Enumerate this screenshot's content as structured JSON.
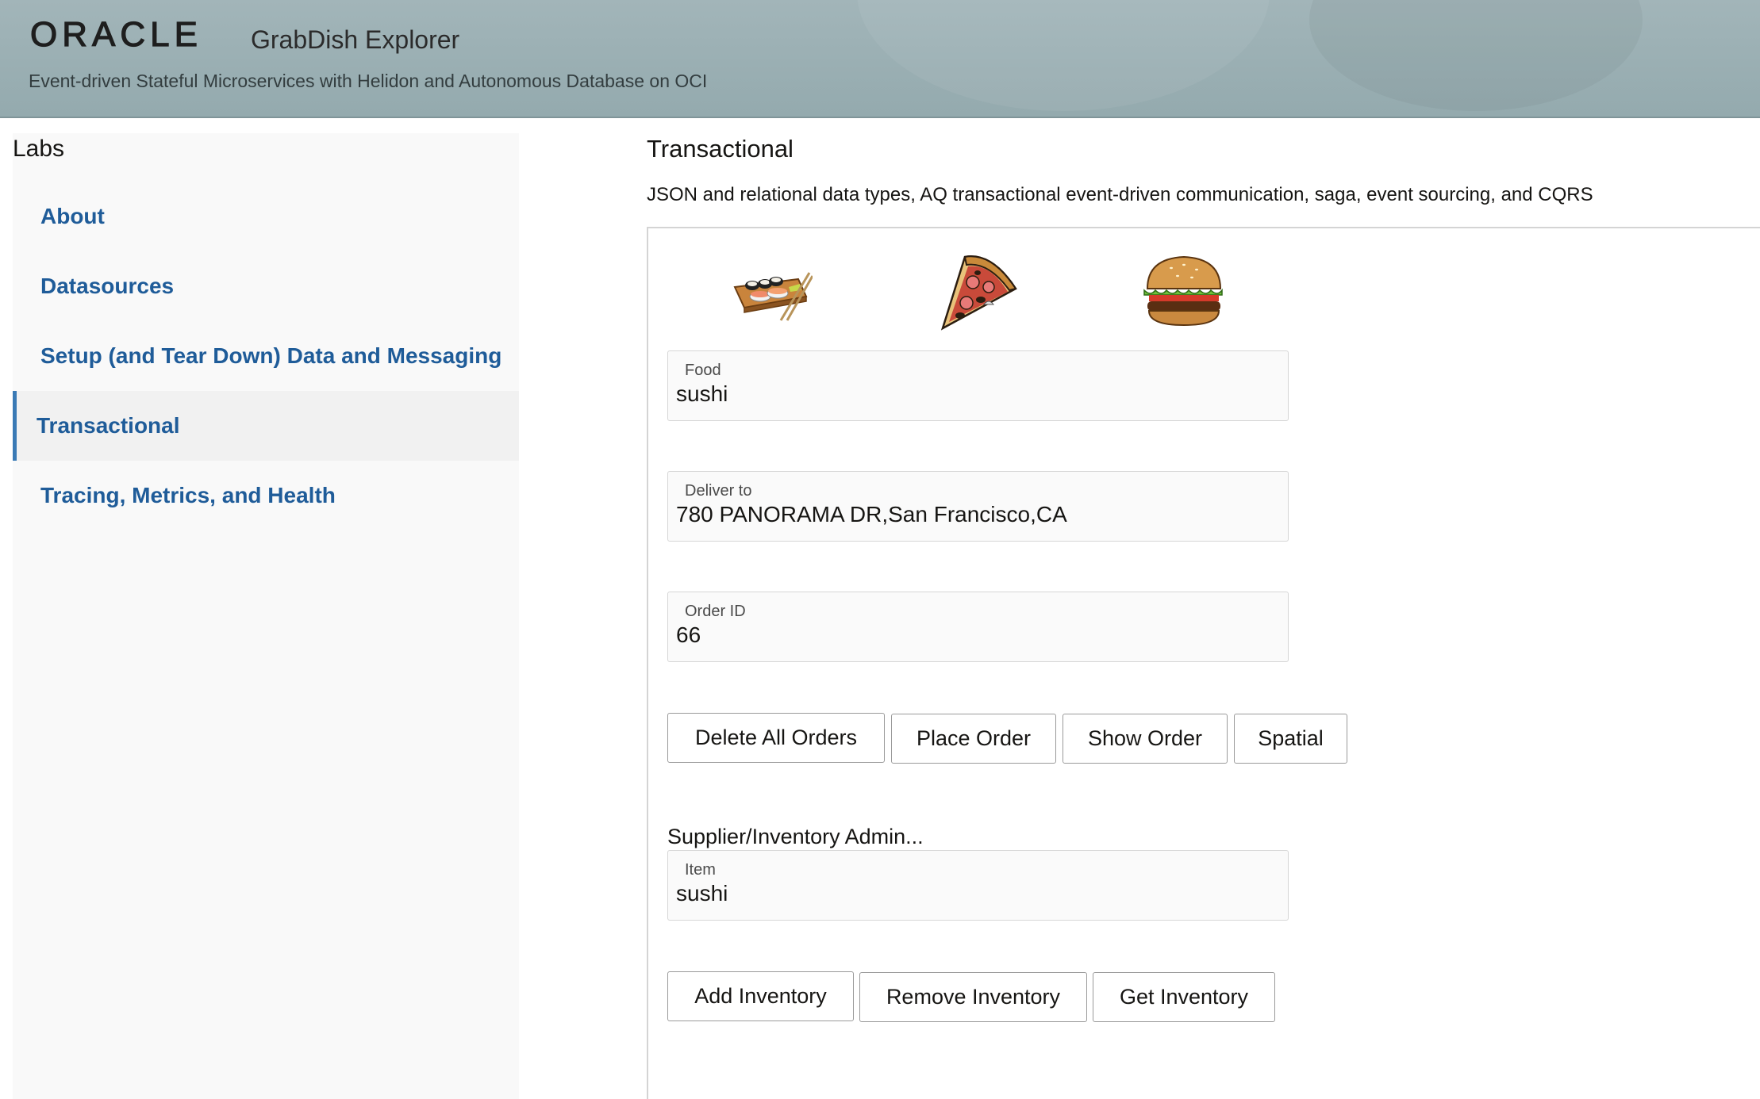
{
  "header": {
    "logo": "ORACLE",
    "title": "GrabDish Explorer",
    "subtitle": "Event-driven Stateful Microservices with Helidon and Autonomous Database on OCI"
  },
  "sidebar": {
    "title": "Labs",
    "items": [
      {
        "label": "About",
        "active": false
      },
      {
        "label": "Datasources",
        "active": false
      },
      {
        "label": "Setup (and Tear Down) Data and Messaging",
        "active": false
      },
      {
        "label": "Transactional",
        "active": true
      },
      {
        "label": "Tracing, Metrics, and Health",
        "active": false
      }
    ]
  },
  "main": {
    "title": "Transactional",
    "description": "JSON and relational data types, AQ transactional event-driven communication, saga, event sourcing, and CQRS",
    "food_icons": [
      "sushi-icon",
      "pizza-icon",
      "burger-icon"
    ],
    "order_form": {
      "food": {
        "label": "Food",
        "value": "sushi"
      },
      "deliver_to": {
        "label": "Deliver to",
        "value": "780 PANORAMA DR,San Francisco,CA"
      },
      "order_id": {
        "label": "Order ID",
        "value": "66"
      }
    },
    "order_buttons": {
      "delete_all": "Delete All Orders",
      "place": "Place Order",
      "show": "Show Order",
      "spatial": "Spatial"
    },
    "supplier": {
      "title": "Supplier/Inventory Admin...",
      "item": {
        "label": "Item",
        "value": "sushi"
      },
      "buttons": {
        "add": "Add Inventory",
        "remove": "Remove Inventory",
        "get": "Get Inventory"
      }
    }
  },
  "colors": {
    "header_bg": "#9bb0b4",
    "nav_link": "#1f5c99",
    "active_indicator": "#3a7ab5",
    "sidebar_bg": "#f9f9f9"
  }
}
